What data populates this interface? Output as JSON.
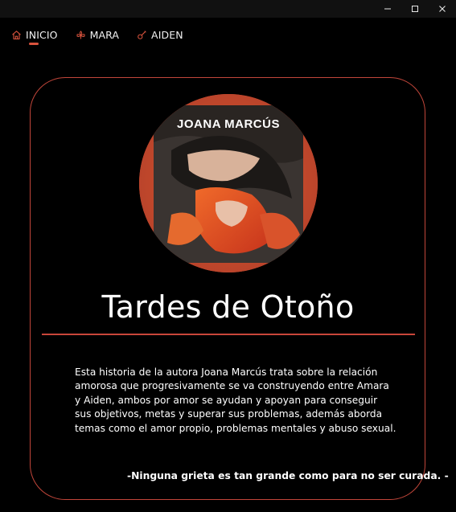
{
  "window": {
    "controls": [
      {
        "name": "minimize",
        "glyph": "—"
      },
      {
        "name": "maximize",
        "glyph": "□"
      },
      {
        "name": "close",
        "glyph": "✕"
      }
    ]
  },
  "nav": {
    "items": [
      {
        "label": "INICIO",
        "icon": "home-icon",
        "active": true
      },
      {
        "label": "MARA",
        "icon": "flower-icon",
        "active": false
      },
      {
        "label": "AIDEN",
        "icon": "guitar-icon",
        "active": false
      }
    ]
  },
  "colors": {
    "accent": "#d9533d",
    "card_border": "#c2463a",
    "background": "#000000",
    "text": "#ffffff"
  },
  "book": {
    "cover_author": "JOANA MARCÚS",
    "title": "Tardes de Otoño",
    "description": "Esta historia de la autora Joana Marcús trata sobre la relación amorosa que progresivamente se va construyendo entre Amara y Aiden, ambos por amor se ayudan y apoyan para conseguir sus objetivos, metas y superar sus problemas, además aborda temas como el amor propio, problemas mentales y abuso sexual.",
    "quote": "-Ninguna grieta es tan grande como para no ser curada. -"
  }
}
